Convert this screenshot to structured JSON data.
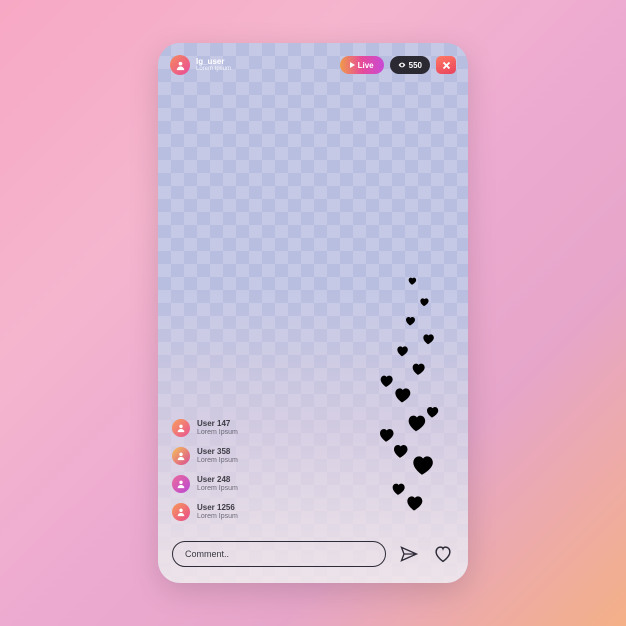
{
  "header": {
    "username": "Ig_user",
    "subline": "Lorem Ipsum",
    "live_label": "Live",
    "viewer_count": "550"
  },
  "comments": [
    {
      "name": "User 147",
      "body": "Lorem Ipsum"
    },
    {
      "name": "User 358",
      "body": "Lorem Ipsum"
    },
    {
      "name": "User 248",
      "body": "Lorem Ipsum"
    },
    {
      "name": "User 1256",
      "body": "Lorem Ipsum"
    }
  ],
  "input": {
    "placeholder": "Comment.."
  }
}
